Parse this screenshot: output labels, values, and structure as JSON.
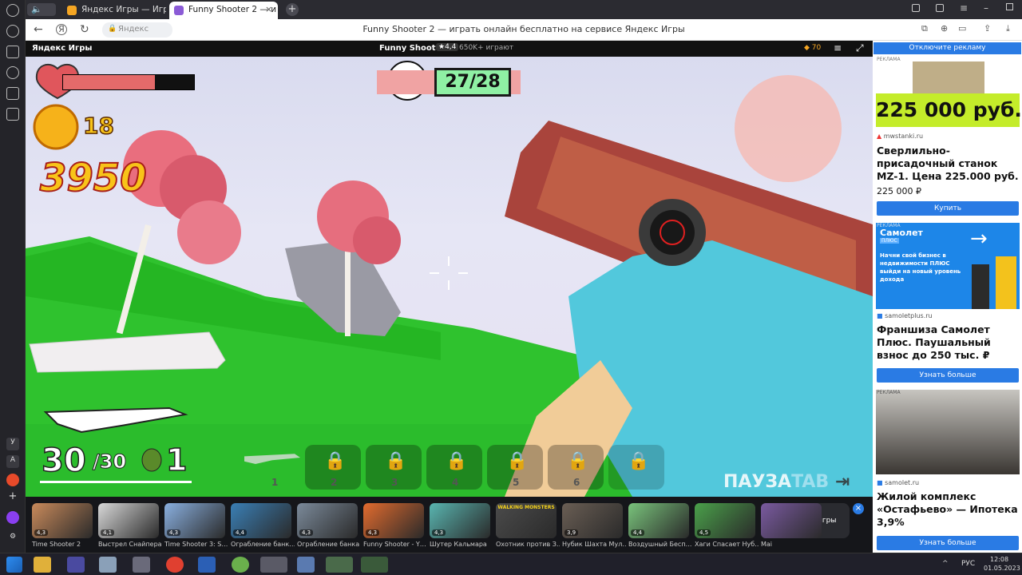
{
  "browser": {
    "tabs": [
      {
        "label": "Яндекс Игры — Игры онл",
        "active": false
      },
      {
        "label": "Funny Shooter 2 — и",
        "active": true
      }
    ],
    "address_host": "Яндекс",
    "page_title": "Funny Shooter 2 — играть онлайн бесплатно на сервисе Яндекс Игры",
    "sidebar_letters": [
      "У",
      "A"
    ]
  },
  "gamebar": {
    "brand": "Яндекс Игры",
    "game_title": "Funny Shooter 2",
    "rating": "4,4",
    "players": "650K+ играют",
    "coins": "70",
    "disable_ads": "Отключите рекламу"
  },
  "hud": {
    "health_fraction": 0.7,
    "coins": "18",
    "score": "3950",
    "kills": "27/28",
    "ammo_current": "30",
    "ammo_total": "/30",
    "grenades": "1",
    "weapon_slots": [
      "1",
      "2",
      "3",
      "4",
      "5",
      "6"
    ],
    "pause": "ПАУЗА",
    "pause_key": "TAB"
  },
  "ads": [
    {
      "label": "РЕКЛАМА",
      "price_banner": "225 000 руб.",
      "domain": "mwstanki.ru",
      "title": "Сверлильно-присадочный станок MZ-1. Цена 225.000 руб.",
      "price": "225 000 ₽",
      "button": "Купить"
    },
    {
      "label": "РЕКЛАМА",
      "brand": "Самолет",
      "brand2": "ПЛЮС",
      "banner_text": "Начни свой бизнес в недвижимости ПЛЮС выйди на новый уровень дохода",
      "domain": "samoletplus.ru",
      "title": "Франшиза Самолет Плюс. Паушальный взнос до 250 тыс. ₽",
      "button": "Узнать больше"
    },
    {
      "label": "РЕКЛАМА",
      "domain": "samolet.ru",
      "title": "Жилой комплекс «Остафьево» — Ипотека 3,9%",
      "button": "Узнать больше"
    }
  ],
  "games": [
    {
      "name": "Time Shooter 2",
      "rating": "4,3",
      "color": "#c98a5b"
    },
    {
      "name": "Выстрел Снайпера",
      "rating": "4,1",
      "color": "#d8d8d8"
    },
    {
      "name": "Time Shooter 3: S…",
      "rating": "4,3",
      "color": "#8ab0e0"
    },
    {
      "name": "Ограбление банк…",
      "rating": "4,4",
      "color": "#3a7fb5"
    },
    {
      "name": "Ограбление банка",
      "rating": "4,3",
      "color": "#7b8a9a"
    },
    {
      "name": "Funny Shooter - Y…",
      "rating": "4,3",
      "color": "#e26b2e"
    },
    {
      "name": "Шутер Кальмара",
      "rating": "4,3",
      "color": "#59b5b0"
    },
    {
      "name": "Охотник против З…",
      "rating": "",
      "color": "#4b4b4b",
      "caption": "WALKING MONSTERS"
    },
    {
      "name": "Нубик Шахта Мул…",
      "rating": "3,9",
      "color": "#6a5e54"
    },
    {
      "name": "Воздушный Бесп…",
      "rating": "4,4",
      "color": "#79c37b"
    },
    {
      "name": "Хаги Спасает Нуб…",
      "rating": "4,5",
      "color": "#4aa04a"
    },
    {
      "name": "Маі",
      "rating": "",
      "color": "#7a5aa0"
    }
  ],
  "all_games": "Все игры",
  "taskbar": {
    "lang": "РУС",
    "time": "12:08",
    "date": "01.05.2023"
  },
  "colors": {
    "yellow_green": "#c4ec2a",
    "samolet_blue": "#1d86e8",
    "button_blue": "#2a7be4",
    "kill_green": "#8ff0a4"
  }
}
